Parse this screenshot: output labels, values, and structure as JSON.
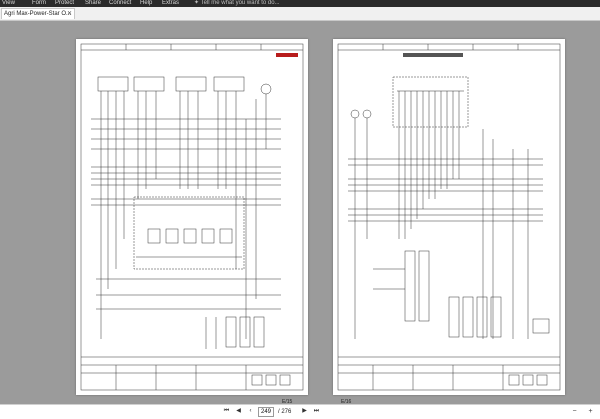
{
  "menu": {
    "view": "View",
    "form": "Form",
    "protect": "Protect",
    "share": "Share",
    "connect": "Connect",
    "help": "Help",
    "extras": "Extras",
    "search_placeholder": "Tell me what you want to do..."
  },
  "document_tab": {
    "title": "Agri Max-Power-Star O..."
  },
  "pages": {
    "left_page_label": "E/15",
    "right_page_label": "E/16"
  },
  "statusbar": {
    "current_page": "249",
    "total_pages": "/ 276"
  },
  "colors": {
    "ribbon": "#2b2b2b",
    "viewer_bg": "#9b9b9b",
    "brand_red": "#b81c1c"
  }
}
